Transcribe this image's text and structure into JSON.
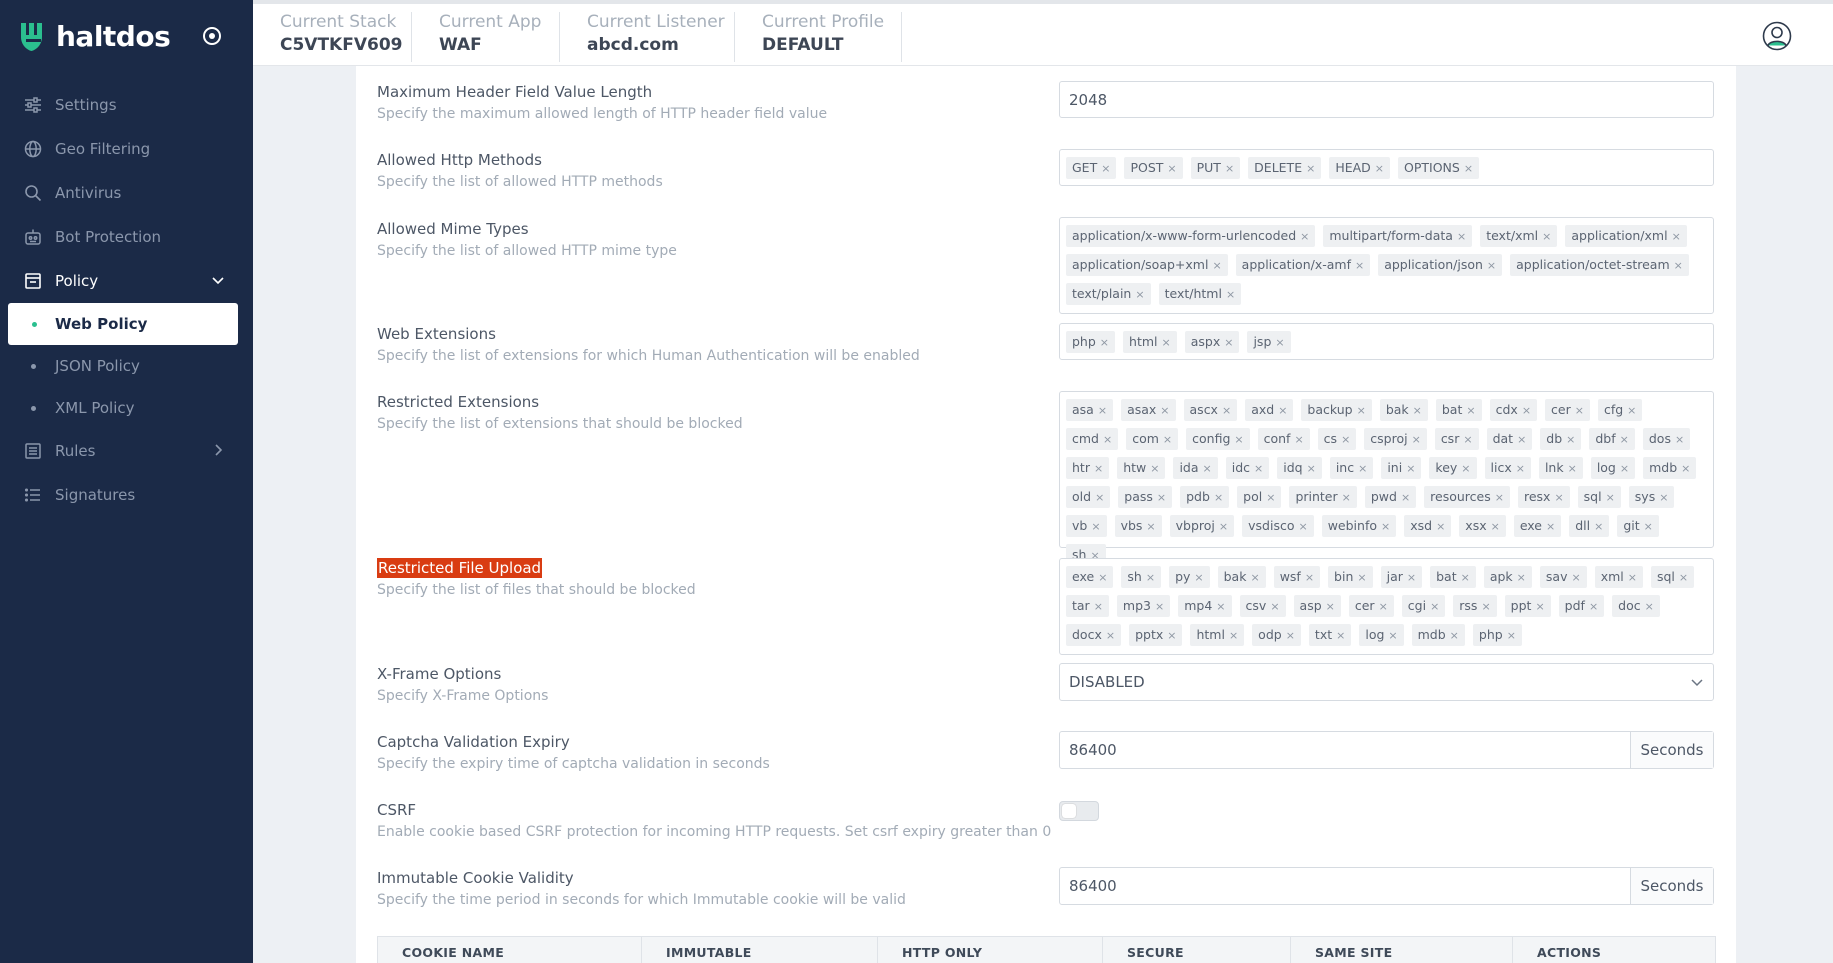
{
  "brand": {
    "name": "haltdos"
  },
  "sidebar": {
    "items": [
      {
        "label": "Settings",
        "icon": "sliders-icon"
      },
      {
        "label": "Geo Filtering",
        "icon": "globe-icon"
      },
      {
        "label": "Antivirus",
        "icon": "search-icon"
      },
      {
        "label": "Bot Protection",
        "icon": "robot-icon"
      },
      {
        "label": "Policy",
        "icon": "policy-icon"
      }
    ],
    "policy_sub": [
      {
        "label": "Web Policy"
      },
      {
        "label": "JSON Policy"
      },
      {
        "label": "XML Policy"
      }
    ],
    "rules": {
      "label": "Rules",
      "icon": "list-icon"
    },
    "signatures": {
      "label": "Signatures",
      "icon": "signatures-icon"
    }
  },
  "header": {
    "stack": {
      "label": "Current Stack",
      "value": "C5VTKFV609"
    },
    "app": {
      "label": "Current App",
      "value": "WAF"
    },
    "listener": {
      "label": "Current Listener",
      "value": "abcd.com"
    },
    "profile": {
      "label": "Current Profile",
      "value": "DEFAULT"
    }
  },
  "settings": {
    "max_header": {
      "title": "Maximum Header Field Value Length",
      "desc": "Specify the maximum allowed length of HTTP header field value",
      "value": "2048"
    },
    "http_methods": {
      "title": "Allowed Http Methods",
      "desc": "Specify the list of allowed HTTP methods",
      "tags": [
        "GET",
        "POST",
        "PUT",
        "DELETE",
        "HEAD",
        "OPTIONS"
      ]
    },
    "mime_types": {
      "title": "Allowed Mime Types",
      "desc": "Specify the list of allowed HTTP mime type",
      "tags": [
        "application/x-www-form-urlencoded",
        "multipart/form-data",
        "text/xml",
        "application/xml",
        "application/soap+xml",
        "application/x-amf",
        "application/json",
        "application/octet-stream",
        "text/plain",
        "text/html"
      ]
    },
    "web_extensions": {
      "title": "Web Extensions",
      "desc": "Specify the list of extensions for which Human Authentication will be enabled",
      "tags": [
        "php",
        "html",
        "aspx",
        "jsp"
      ]
    },
    "restricted_ext": {
      "title": "Restricted Extensions",
      "desc": "Specify the list of extensions that should be blocked",
      "tags": [
        "asa",
        "asax",
        "ascx",
        "axd",
        "backup",
        "bak",
        "bat",
        "cdx",
        "cer",
        "cfg",
        "cmd",
        "com",
        "config",
        "conf",
        "cs",
        "csproj",
        "csr",
        "dat",
        "db",
        "dbf",
        "dos",
        "htr",
        "htw",
        "ida",
        "idc",
        "idq",
        "inc",
        "ini",
        "key",
        "licx",
        "lnk",
        "log",
        "mdb",
        "old",
        "pass",
        "pdb",
        "pol",
        "printer",
        "pwd",
        "resources",
        "resx",
        "sql",
        "sys",
        "vb",
        "vbs",
        "vbproj",
        "vsdisco",
        "webinfo",
        "xsd",
        "xsx",
        "exe",
        "dll",
        "git",
        "sh"
      ]
    },
    "restricted_upload": {
      "title": "Restricted File Upload",
      "desc": "Specify the list of files that should be blocked",
      "tags": [
        "exe",
        "sh",
        "py",
        "bak",
        "wsf",
        "bin",
        "jar",
        "bat",
        "apk",
        "sav",
        "xml",
        "sql",
        "tar",
        "mp3",
        "mp4",
        "csv",
        "asp",
        "cer",
        "cgi",
        "rss",
        "ppt",
        "pdf",
        "doc",
        "docx",
        "pptx",
        "html",
        "odp",
        "txt",
        "log",
        "mdb",
        "php"
      ]
    },
    "xframe": {
      "title": "X-Frame Options",
      "desc": "Specify X-Frame Options",
      "value": "DISABLED"
    },
    "captcha": {
      "title": "Captcha Validation Expiry",
      "desc": "Specify the expiry time of captcha validation in seconds",
      "value": "86400",
      "unit": "Seconds"
    },
    "csrf": {
      "title": "CSRF",
      "desc": "Enable cookie based CSRF protection for incoming HTTP requests. Set csrf expiry greater than 0",
      "enabled": false
    },
    "immutable_cookie": {
      "title": "Immutable Cookie Validity",
      "desc": "Specify the time period in seconds for which Immutable cookie will be valid",
      "value": "86400",
      "unit": "Seconds"
    }
  },
  "cookie_table": {
    "columns": [
      "COOKIE NAME",
      "IMMUTABLE",
      "HTTP ONLY",
      "SECURE",
      "SAME SITE",
      "ACTIONS"
    ]
  },
  "colors": {
    "sidebar_bg": "#1b2a47",
    "accent": "#2bbf8f",
    "highlight": "#d93c12"
  }
}
